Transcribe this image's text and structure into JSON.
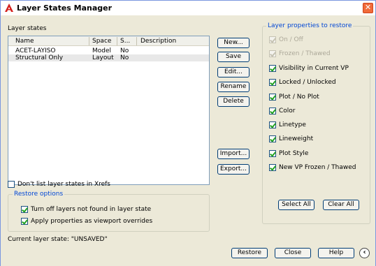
{
  "window": {
    "title": "Layer States Manager",
    "close_glyph": "✕"
  },
  "layer_states": {
    "label": "Layer states",
    "columns": [
      "Name",
      "Space",
      "S...",
      "Description"
    ],
    "rows": [
      {
        "name": "ACET-LAYISO",
        "space": "Model",
        "s": "No",
        "description": ""
      },
      {
        "name": "Structural Only",
        "space": "Layout",
        "s": "No",
        "description": ""
      }
    ]
  },
  "buttons": {
    "new": "New...",
    "save": "Save",
    "edit": "Edit...",
    "rename": "Rename",
    "delete": "Delete",
    "import": "Import...",
    "export": "Export...",
    "select_all": "Select All",
    "clear_all": "Clear All",
    "restore": "Restore",
    "close": "Close",
    "help": "Help"
  },
  "dont_list_xrefs": {
    "label": "Don't list layer states in Xrefs",
    "checked": false
  },
  "restore_options": {
    "title": "Restore options",
    "turn_off": {
      "label": "Turn off layers not found in layer state",
      "checked": true
    },
    "apply_viewport": {
      "label": "Apply properties as viewport overrides",
      "checked": true
    }
  },
  "current_state": "Current layer state: \"UNSAVED\"",
  "properties": {
    "title": "Layer properties to restore",
    "items": [
      {
        "label": "On / Off",
        "checked": true,
        "disabled": true
      },
      {
        "label": "Frozen / Thawed",
        "checked": true,
        "disabled": true
      },
      {
        "label": "Visibility in Current VP",
        "checked": true,
        "disabled": false
      },
      {
        "label": "Locked / Unlocked",
        "checked": true,
        "disabled": false
      },
      {
        "label": "Plot / No Plot",
        "checked": true,
        "disabled": false
      },
      {
        "label": "Color",
        "checked": true,
        "disabled": false
      },
      {
        "label": "Linetype",
        "checked": true,
        "disabled": false
      },
      {
        "label": "Lineweight",
        "checked": true,
        "disabled": false
      },
      {
        "label": "Plot Style",
        "checked": true,
        "disabled": false
      },
      {
        "label": "New VP Frozen / Thawed",
        "checked": true,
        "disabled": false
      }
    ]
  },
  "help_arrow_glyph": "‹"
}
